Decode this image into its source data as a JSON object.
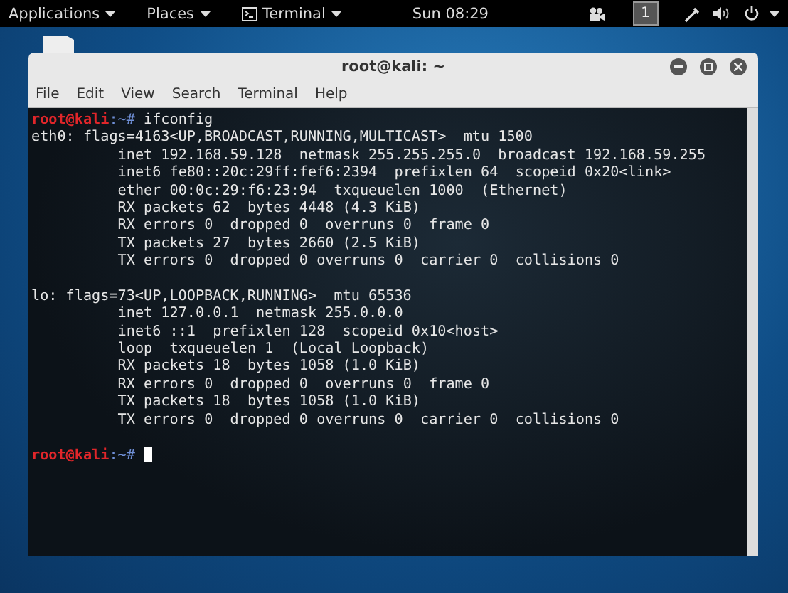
{
  "top_bar": {
    "menus": [
      "Applications",
      "Places",
      "Terminal"
    ],
    "clock": "Sun 08:29",
    "workspace": "1"
  },
  "window": {
    "title": "root@kali: ~",
    "menu": [
      "File",
      "Edit",
      "View",
      "Search",
      "Terminal",
      "Help"
    ]
  },
  "terminal": {
    "lines": [
      {
        "kind": "prompt",
        "user": "root@kali",
        "path": ":~#",
        "command": "ifconfig",
        "cursor": false
      },
      {
        "kind": "header",
        "text": "eth0: flags=4163<UP,BROADCAST,RUNNING,MULTICAST>  mtu 1500"
      },
      {
        "kind": "detail",
        "text": "inet 192.168.59.128  netmask 255.255.255.0  broadcast 192.168.59.255"
      },
      {
        "kind": "detail",
        "text": "inet6 fe80::20c:29ff:fef6:2394  prefixlen 64  scopeid 0x20<link>"
      },
      {
        "kind": "detail",
        "text": "ether 00:0c:29:f6:23:94  txqueuelen 1000  (Ethernet)"
      },
      {
        "kind": "detail",
        "text": "RX packets 62  bytes 4448 (4.3 KiB)"
      },
      {
        "kind": "detail",
        "text": "RX errors 0  dropped 0  overruns 0  frame 0"
      },
      {
        "kind": "detail",
        "text": "TX packets 27  bytes 2660 (2.5 KiB)"
      },
      {
        "kind": "detail",
        "text": "TX errors 0  dropped 0 overruns 0  carrier 0  collisions 0"
      },
      {
        "kind": "blank"
      },
      {
        "kind": "header",
        "text": "lo: flags=73<UP,LOOPBACK,RUNNING>  mtu 65536"
      },
      {
        "kind": "detail",
        "text": "inet 127.0.0.1  netmask 255.0.0.0"
      },
      {
        "kind": "detail",
        "text": "inet6 ::1  prefixlen 128  scopeid 0x10<host>"
      },
      {
        "kind": "detail",
        "text": "loop  txqueuelen 1  (Local Loopback)"
      },
      {
        "kind": "detail",
        "text": "RX packets 18  bytes 1058 (1.0 KiB)"
      },
      {
        "kind": "detail",
        "text": "RX errors 0  dropped 0  overruns 0  frame 0"
      },
      {
        "kind": "detail",
        "text": "TX packets 18  bytes 1058 (1.0 KiB)"
      },
      {
        "kind": "detail",
        "text": "TX errors 0  dropped 0 overruns 0  carrier 0  collisions 0"
      },
      {
        "kind": "blank"
      },
      {
        "kind": "prompt",
        "user": "root@kali",
        "path": ":~#",
        "cursor": true
      }
    ]
  }
}
